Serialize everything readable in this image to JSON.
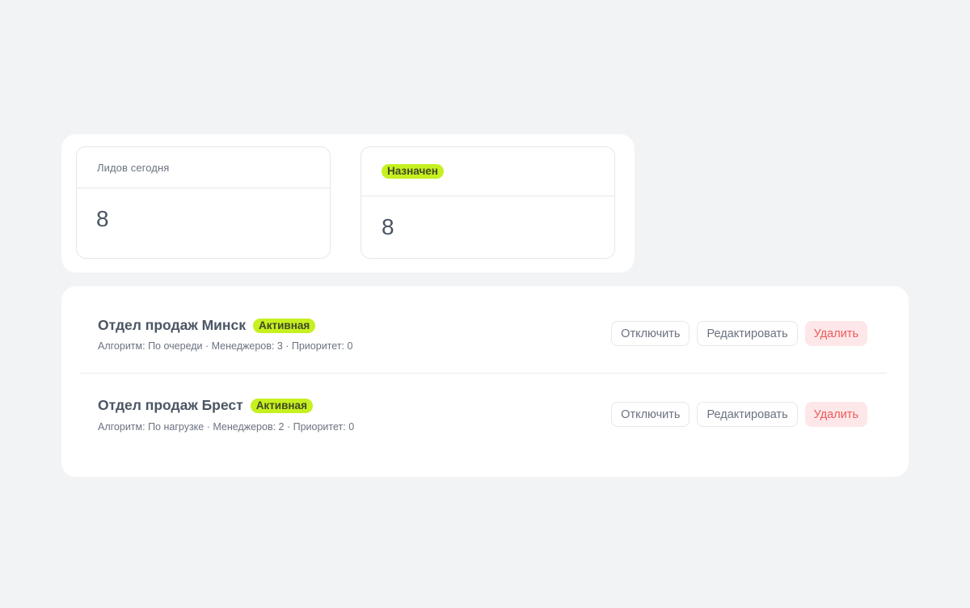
{
  "stats": [
    {
      "label": "Лидов сегодня",
      "value": "8"
    },
    {
      "badge": "Назначен",
      "value": "8"
    }
  ],
  "groups": [
    {
      "name": "Отдел продаж Минск",
      "status": "Активная",
      "meta": "Алгоритм: По очереди · Менеджеров: 3 · Приоритет: 0",
      "actions": {
        "disable": "Отключить",
        "edit": "Редактировать",
        "delete": "Удалить"
      }
    },
    {
      "name": "Отдел продаж Брест",
      "status": "Активная",
      "meta": "Алгоритм: По нагрузке · Менеджеров: 2 · Приоритет: 0",
      "actions": {
        "disable": "Отключить",
        "edit": "Редактировать",
        "delete": "Удалить"
      }
    }
  ],
  "colors": {
    "background": "#f2f3f5",
    "badge": "#c6f01f",
    "danger_bg": "#fde7e9",
    "danger_text": "#ef5a5a"
  }
}
